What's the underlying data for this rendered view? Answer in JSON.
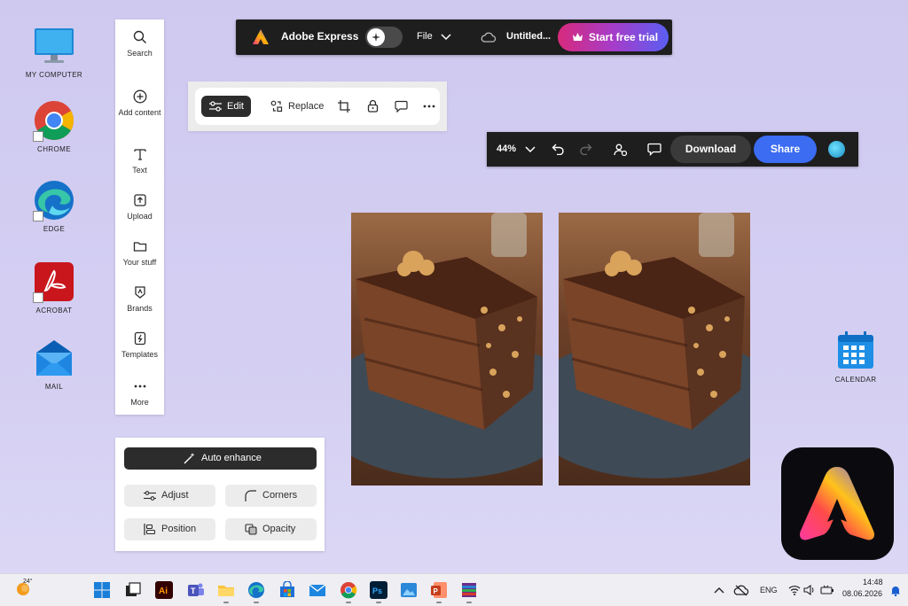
{
  "desktop": {
    "icons": [
      {
        "label": "MY COMPUTER"
      },
      {
        "label": "CHROME"
      },
      {
        "label": "EDGE"
      },
      {
        "label": "ACROBAT"
      },
      {
        "label": "MAIL"
      },
      {
        "label": "CALENDAR"
      }
    ]
  },
  "rail": {
    "items": [
      {
        "label": "Search",
        "icon": "search-icon"
      },
      {
        "label": "Add content",
        "icon": "plus-circle-icon"
      },
      {
        "label": "Text",
        "icon": "text-icon"
      },
      {
        "label": "Upload",
        "icon": "upload-icon"
      },
      {
        "label": "Your stuff",
        "icon": "folder-icon"
      },
      {
        "label": "Brands",
        "icon": "brand-icon"
      },
      {
        "label": "Templates",
        "icon": "templates-icon"
      },
      {
        "label": "More",
        "icon": "more-icon"
      }
    ]
  },
  "topbar": {
    "app_name": "Adobe Express",
    "file_label": "File",
    "doc_title": "Untitled...",
    "trial_label": "Start free trial",
    "accent_gradient": [
      "#d72a7c",
      "#a63cc9",
      "#5b5ef2"
    ]
  },
  "context_toolbar": {
    "edit_label": "Edit",
    "replace_label": "Replace"
  },
  "zoom_bar": {
    "zoom": "44%",
    "download_label": "Download",
    "share_label": "Share",
    "share_color": "#3b6cf2"
  },
  "adjust_panel": {
    "auto_enhance_label": "Auto enhance",
    "adjust_label": "Adjust",
    "corners_label": "Corners",
    "position_label": "Position",
    "opacity_label": "Opacity"
  },
  "taskbar": {
    "weather_temp": "24°",
    "language": "ENG",
    "time": "14:48",
    "date": "08.06.2026"
  }
}
